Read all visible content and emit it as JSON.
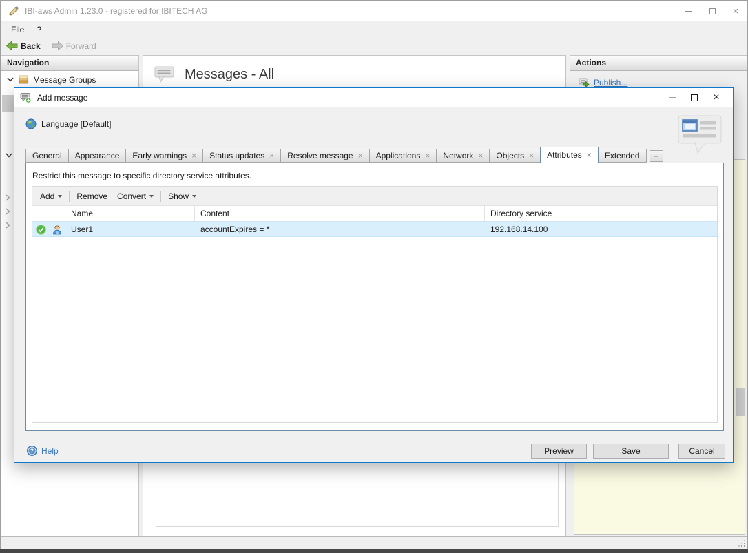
{
  "glyphs": {
    "close": "×",
    "tab_close": "×",
    "plus": "+"
  },
  "window": {
    "title": "IBI-aws Admin 1.23.0 - registered for IBITECH AG"
  },
  "menu": {
    "file": "File",
    "help": "?"
  },
  "toolbar": {
    "back": "Back",
    "forward": "Forward"
  },
  "navigation": {
    "header": "Navigation",
    "message_groups": "Message Groups"
  },
  "main": {
    "title": "Messages - All"
  },
  "actions": {
    "header": "Actions",
    "publish": "Publish..."
  },
  "dialog": {
    "title": "Add message",
    "language": "Language [Default]",
    "tabs": [
      {
        "label": "General"
      },
      {
        "label": "Appearance"
      },
      {
        "label": "Early warnings"
      },
      {
        "label": "Status updates"
      },
      {
        "label": "Resolve message"
      },
      {
        "label": "Applications"
      },
      {
        "label": "Network"
      },
      {
        "label": "Objects"
      },
      {
        "label": "Attributes"
      },
      {
        "label": "Extended"
      }
    ],
    "description": "Restrict this message to specific directory service attributes.",
    "grid_toolbar": {
      "add": "Add",
      "remove": "Remove",
      "convert": "Convert",
      "show": "Show"
    },
    "table": {
      "columns": {
        "name": "Name",
        "content": "Content",
        "directory": "Directory service"
      },
      "row": {
        "name": "User1",
        "content": "accountExpires = *",
        "directory": "192.168.14.100"
      }
    },
    "help": "Help",
    "buttons": {
      "preview": "Preview",
      "save": "Save",
      "cancel": "Cancel"
    }
  }
}
